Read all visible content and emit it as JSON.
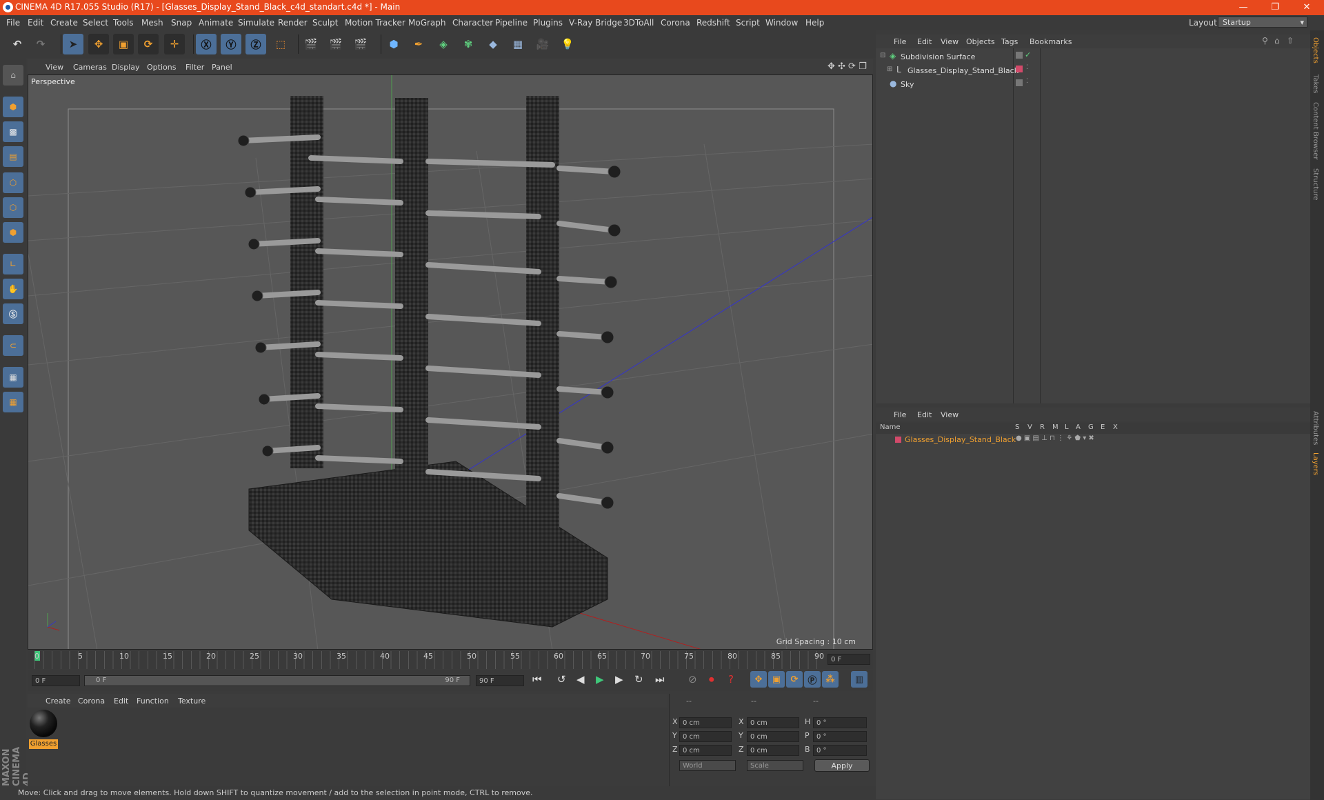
{
  "window": {
    "title": "CINEMA 4D R17.055 Studio (R17) - [Glasses_Display_Stand_Black_c4d_standart.c4d *] - Main",
    "minimize": "—",
    "maximize": "❐",
    "close": "✕"
  },
  "menubar": {
    "items": [
      "File",
      "Edit",
      "Create",
      "Select",
      "Tools",
      "Mesh",
      "Snap",
      "Animate",
      "Simulate",
      "Render",
      "Sculpt",
      "Motion Tracker",
      "MoGraph",
      "Character",
      "Pipeline",
      "Plugins",
      "V-Ray Bridge",
      "3DToAll",
      "Corona",
      "Redshift",
      "Script",
      "Window",
      "Help"
    ],
    "layout_label": "Layout:",
    "layout_value": "Startup"
  },
  "viewport": {
    "menu": [
      "View",
      "Cameras",
      "Display",
      "Options",
      "Filter",
      "Panel"
    ],
    "label": "Perspective",
    "grid_spacing": "Grid Spacing : 10 cm"
  },
  "timeline": {
    "ticks": [
      "0",
      "5",
      "10",
      "15",
      "20",
      "25",
      "30",
      "35",
      "40",
      "45",
      "50",
      "55",
      "60",
      "65",
      "70",
      "75",
      "80",
      "85",
      "90"
    ],
    "current_frame": "0 F",
    "start_field": "0 F",
    "range_start": "0 F",
    "range_end": "90 F",
    "end_field": "90 F"
  },
  "material_manager": {
    "menu": [
      "Create",
      "Corona",
      "Edit",
      "Function",
      "Texture"
    ],
    "materials": [
      {
        "name": "Glasses"
      }
    ]
  },
  "coordinates": {
    "headers": [
      "--",
      "--",
      "--"
    ],
    "rows": [
      {
        "a": "X",
        "av": "0 cm",
        "b": "X",
        "bv": "0 cm",
        "c": "H",
        "cv": "0 °"
      },
      {
        "a": "Y",
        "av": "0 cm",
        "b": "Y",
        "bv": "0 cm",
        "c": "P",
        "cv": "0 °"
      },
      {
        "a": "Z",
        "av": "0 cm",
        "b": "Z",
        "bv": "0 cm",
        "c": "B",
        "cv": "0 °"
      }
    ],
    "space": "World",
    "mode": "Scale",
    "apply": "Apply"
  },
  "object_manager": {
    "menu": [
      "File",
      "Edit",
      "View",
      "Objects",
      "Tags",
      "Bookmarks"
    ],
    "objects": [
      {
        "name": "Subdivision Surface",
        "color": "#7fd07f"
      },
      {
        "name": "Glasses_Display_Stand_Black",
        "color": "#c8c8c8"
      },
      {
        "name": "Sky",
        "color": "#9ab8de"
      }
    ]
  },
  "layer_manager": {
    "menu": [
      "File",
      "Edit",
      "View"
    ],
    "columns": [
      "Name",
      "S",
      "V",
      "R",
      "M",
      "L",
      "A",
      "G",
      "E",
      "X"
    ],
    "layers": [
      {
        "name": "Glasses_Display_Stand_Black",
        "color": "#d24a6a"
      }
    ]
  },
  "right_tabs": [
    "Objects",
    "Takes",
    "Content Browser",
    "Structure",
    "Attributes",
    "Layers"
  ],
  "branding": "MAXON CINEMA 4D",
  "status": "Move: Click and drag to move elements. Hold down SHIFT to quantize movement / add to the selection in point mode, CTRL to remove.",
  "colors": {
    "accent": "#e8491d",
    "tool_blue": "#4c6f98",
    "layer_name": "#f0a030"
  }
}
